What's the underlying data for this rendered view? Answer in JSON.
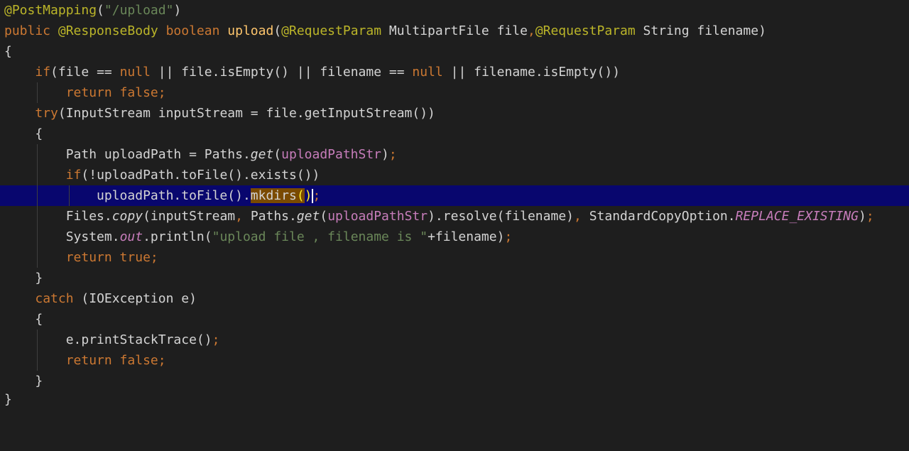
{
  "editor": {
    "language": "Java",
    "colors": {
      "background": "#1e1e1e",
      "current_line": "#08066e",
      "keyword": "#cc7832",
      "annotation": "#bbb529",
      "method": "#ffc66d",
      "string": "#6a8759",
      "field": "#c77dbb",
      "text": "#d4d4d4"
    },
    "current_line_index": 9,
    "lines": [
      "@PostMapping(\"/upload\")",
      "public @ResponseBody boolean upload(@RequestParam MultipartFile file,@RequestParam String filename)",
      "{",
      "    if(file == null || file.isEmpty() || filename == null || filename.isEmpty())",
      "        return false;",
      "    try(InputStream inputStream = file.getInputStream())",
      "    {",
      "        Path uploadPath = Paths.get(uploadPathStr);",
      "        if(!uploadPath.toFile().exists())",
      "            uploadPath.toFile().mkdirs();",
      "        Files.copy(inputStream, Paths.get(uploadPathStr).resolve(filename), StandardCopyOption.REPLACE_EXISTING);",
      "        System.out.println(\"upload file , filename is \"+filename);",
      "        return true;",
      "    }",
      "    catch (IOException e)",
      "    {",
      "        e.printStackTrace();",
      "        return false;",
      "    }",
      "}"
    ]
  }
}
